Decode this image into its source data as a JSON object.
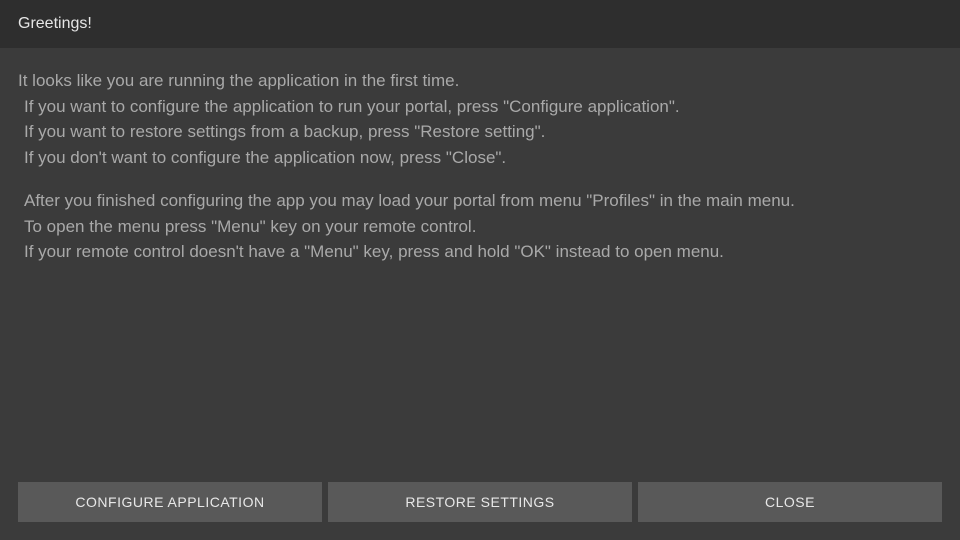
{
  "header": {
    "title": "Greetings!"
  },
  "body": {
    "line1": "It looks like you are running the application in the first time.",
    "line2": "If you want to configure the application to run your portal, press \"Configure application\".",
    "line3": "If you want to restore settings from a backup, press \"Restore setting\".",
    "line4": "If you don't want to configure the application now, press \"Close\".",
    "line5": "After you finished configuring the app you may load your portal from menu \"Profiles\" in the main menu.",
    "line6": "To open the menu press \"Menu\" key on your remote control.",
    "line7": "If your remote control doesn't have a \"Menu\" key, press and hold \"OK\" instead to open menu."
  },
  "buttons": {
    "configure": "CONFIGURE APPLICATION",
    "restore": "RESTORE SETTINGS",
    "close": "CLOSE"
  }
}
